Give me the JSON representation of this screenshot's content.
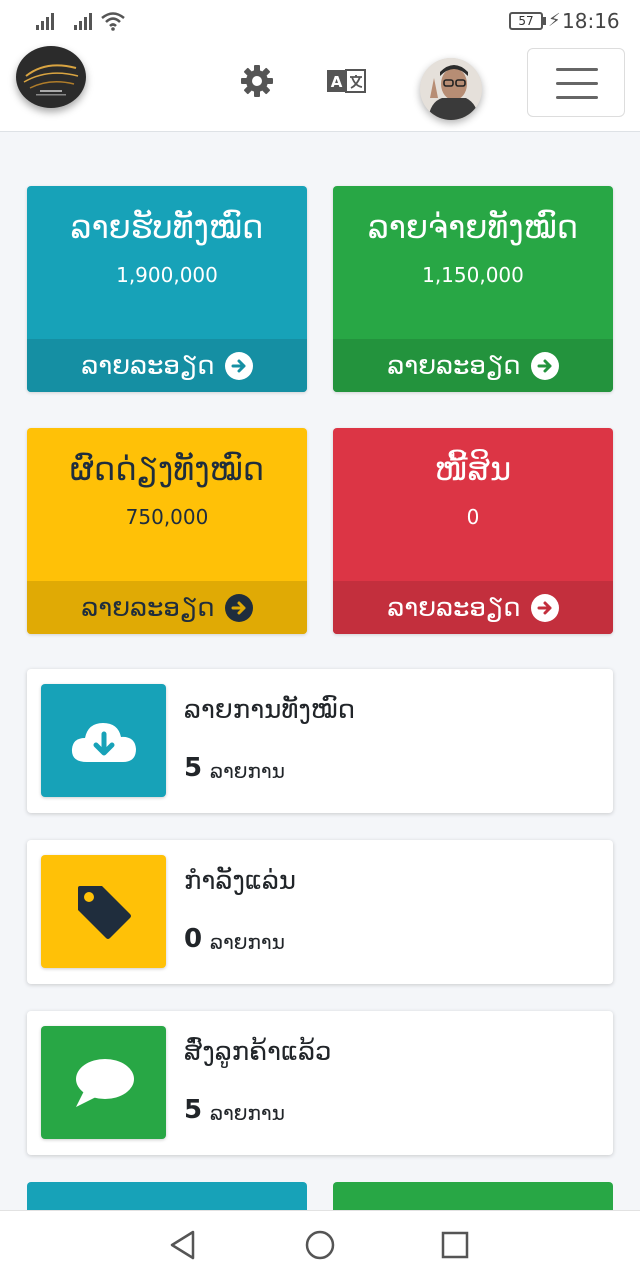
{
  "status_bar": {
    "time": "18:16",
    "battery": "57"
  },
  "navbar": {
    "icons": [
      "settings-gear-icon",
      "translate-icon",
      "hamburger-menu-icon"
    ]
  },
  "stat_boxes": [
    {
      "title": "ລາຍຮັບທັງໝົດ",
      "value": "1,900,000",
      "footer": "ລາຍລະອຽດ",
      "color": "#17a2b8"
    },
    {
      "title": "ລາຍຈ່າຍທັງໝົດ",
      "value": "1,150,000",
      "footer": "ລາຍລະອຽດ",
      "color": "#28a745"
    },
    {
      "title": "ຜົດດ່ຽງທັງໝົດ",
      "value": "750,000",
      "footer": "ລາຍລະອຽດ",
      "color": "#ffc107"
    },
    {
      "title": "ໜີ້ສິນ",
      "value": "0",
      "footer": "ລາຍລະອຽດ",
      "color": "#dc3545"
    }
  ],
  "info_boxes": [
    {
      "label": "ລາຍການທັງໝົດ",
      "count": "5",
      "unit": "ລາຍການ",
      "icon": "cloud-download-icon",
      "color": "#17a2b8"
    },
    {
      "label": "ກຳລັງແລ່ນ",
      "count": "0",
      "unit": "ລາຍການ",
      "icon": "tag-icon",
      "color": "#ffc107"
    },
    {
      "label": "ສົ່ງລູກຄ້າແລ້ວ",
      "count": "5",
      "unit": "ລາຍການ",
      "icon": "chat-bubble-icon",
      "color": "#28a745"
    }
  ]
}
